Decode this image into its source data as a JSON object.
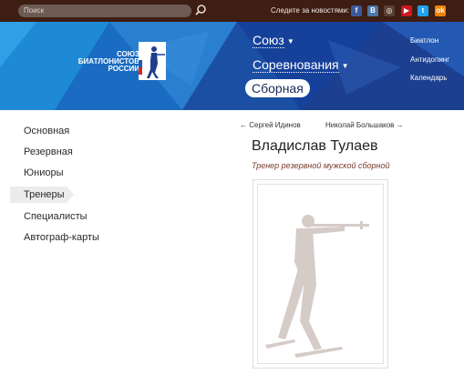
{
  "topbar": {
    "search_placeholder": "Поиск",
    "follow_label": "Следите за новостями:",
    "social": [
      {
        "icon": "facebook-icon",
        "glyph": "f",
        "color": "#3b5998"
      },
      {
        "icon": "vk-icon",
        "glyph": "B",
        "color": "#4a76a8"
      },
      {
        "icon": "instagram-icon",
        "glyph": "◎",
        "color": "#5a4032"
      },
      {
        "icon": "youtube-icon",
        "glyph": "▶",
        "color": "#cc181e"
      },
      {
        "icon": "twitter-icon",
        "glyph": "t",
        "color": "#1da1f2"
      },
      {
        "icon": "odnoklassniki-icon",
        "glyph": "ok",
        "color": "#ee8208"
      }
    ]
  },
  "header": {
    "logo": {
      "line1": "СОЮЗ",
      "line2": "БИАТЛОНИСТОВ",
      "line3": "РОССИИ"
    },
    "nav_main": {
      "union": "Союз",
      "competitions": "Соревнования",
      "team": "Сборная"
    },
    "nav_side": {
      "biathlon": "Биатлон",
      "antidoping": "Антидопинг",
      "calendar": "Календарь"
    }
  },
  "sidebar": {
    "items": [
      {
        "label": "Основная"
      },
      {
        "label": "Резервная"
      },
      {
        "label": "Юниоры"
      },
      {
        "label": "Тренеры",
        "active": true
      },
      {
        "label": "Специалисты"
      },
      {
        "label": "Автограф-карты"
      }
    ]
  },
  "content": {
    "prev": "← Сергей Идинов",
    "next": "Николай Большаков →",
    "name": "Владислав Тулаев",
    "role": "Тренер резервной мужской сборной"
  },
  "colors": {
    "topbar": "#3e1d12",
    "header_blue": "#1c5bb5",
    "active_bg": "#ececec",
    "role_text": "#7a3b2a",
    "silhouette": "#d5cbc7"
  }
}
